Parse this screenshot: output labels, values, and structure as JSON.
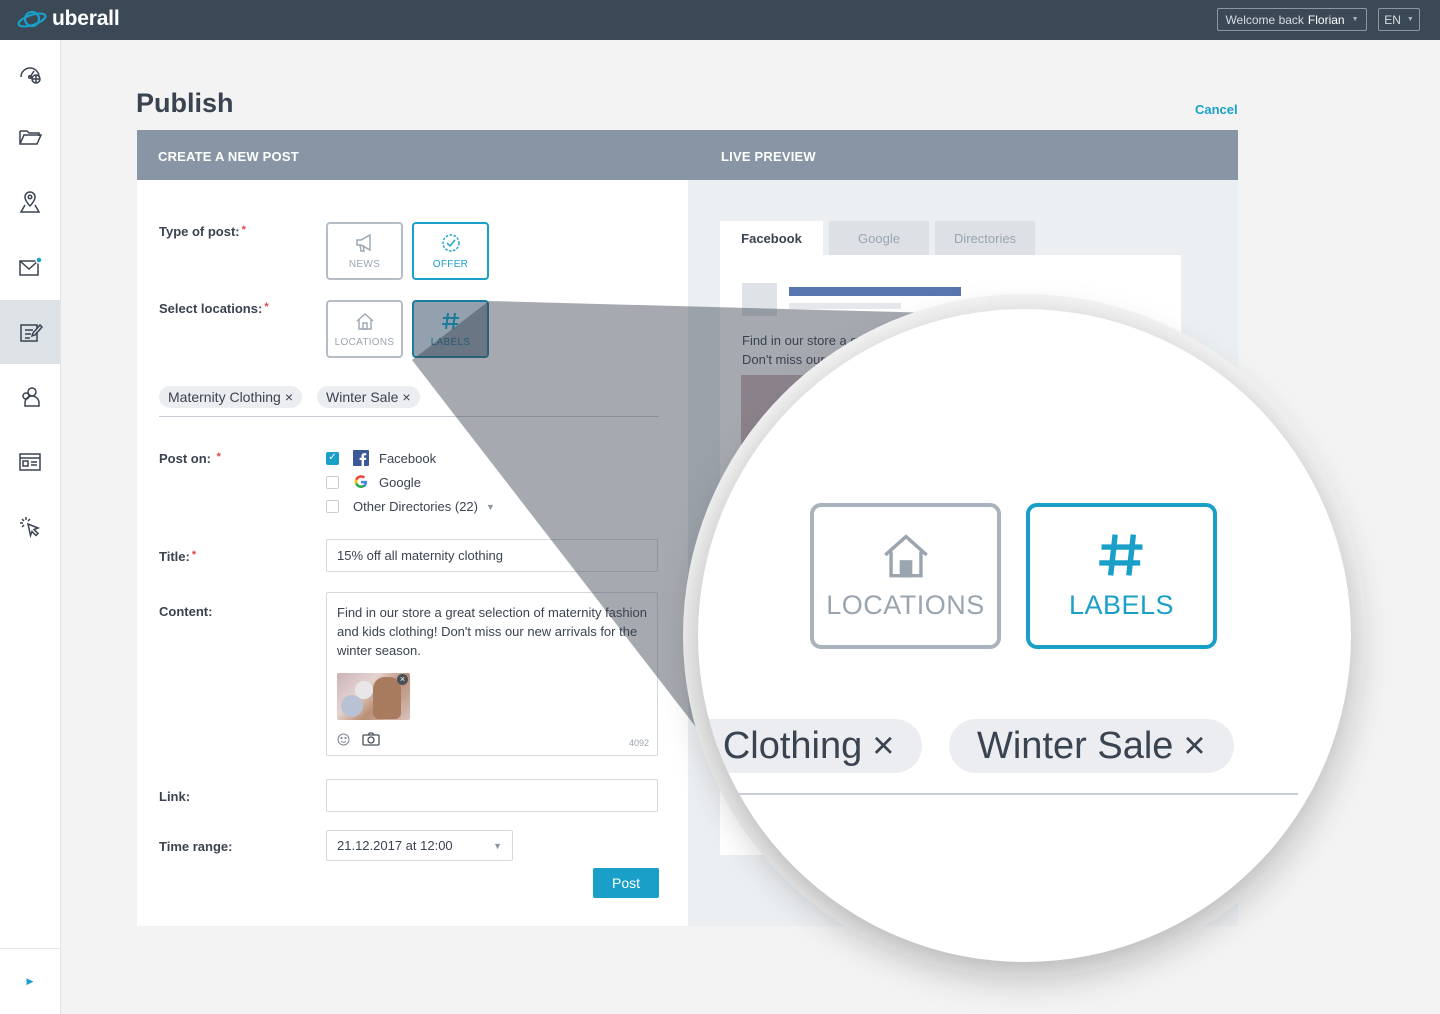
{
  "app": {
    "brand": "uberall"
  },
  "topbar": {
    "welcome_prefix": "Welcome back",
    "user_name": "Florian",
    "language": "EN"
  },
  "page": {
    "title": "Publish",
    "cancel_label": "Cancel"
  },
  "card": {
    "left_header": "CREATE A NEW POST",
    "right_header": "LIVE PREVIEW"
  },
  "form": {
    "type_label": "Type of post:",
    "type_options": [
      {
        "label": "NEWS",
        "icon": "megaphone-icon",
        "selected": false
      },
      {
        "label": "OFFER",
        "icon": "badge-check-icon",
        "selected": true
      }
    ],
    "locations_label": "Select locations:",
    "location_options": [
      {
        "label": "LOCATIONS",
        "icon": "house-icon",
        "selected": false
      },
      {
        "label": "LABELS",
        "icon": "hashtag-icon",
        "selected": true
      }
    ],
    "tags": [
      "Maternity Clothing",
      "Winter Sale"
    ],
    "tag_remove": "×",
    "post_on_label": "Post on:",
    "networks": [
      {
        "name": "Facebook",
        "checked": true,
        "icon": "facebook-icon"
      },
      {
        "name": "Google",
        "checked": false,
        "icon": "google-icon"
      },
      {
        "name": "Other Directories (22)",
        "checked": false,
        "icon": ""
      }
    ],
    "title_label": "Title:",
    "title_value": "15% off all maternity clothing",
    "content_label": "Content:",
    "content_value": "Find in our store a great selection of maternity fashion and kids clothing! Don't miss our new arrivals for the winter season.",
    "char_counter": "4092",
    "link_label": "Link:",
    "link_value": "",
    "time_label": "Time range:",
    "time_value": "21.12.2017 at 12:00",
    "submit_label": "Post",
    "required_mark": "*"
  },
  "preview": {
    "tabs": [
      {
        "label": "Facebook",
        "active": true
      },
      {
        "label": "Google",
        "active": false
      },
      {
        "label": "Directories",
        "active": false
      }
    ],
    "text": "Find in our store a great selection of maternity fashion and kids clothing! Don't miss our new arrivals for the winter season."
  },
  "magnifier": {
    "buttons": [
      {
        "label": "LOCATIONS",
        "active": false
      },
      {
        "label": "LABELS",
        "active": true
      }
    ],
    "tags": [
      "Maternity Clothing",
      "Winter Sale"
    ]
  },
  "colors": {
    "accent": "#1aa0c8",
    "topbar": "#3b4957",
    "header": "#8795a4",
    "required": "#e04848"
  }
}
